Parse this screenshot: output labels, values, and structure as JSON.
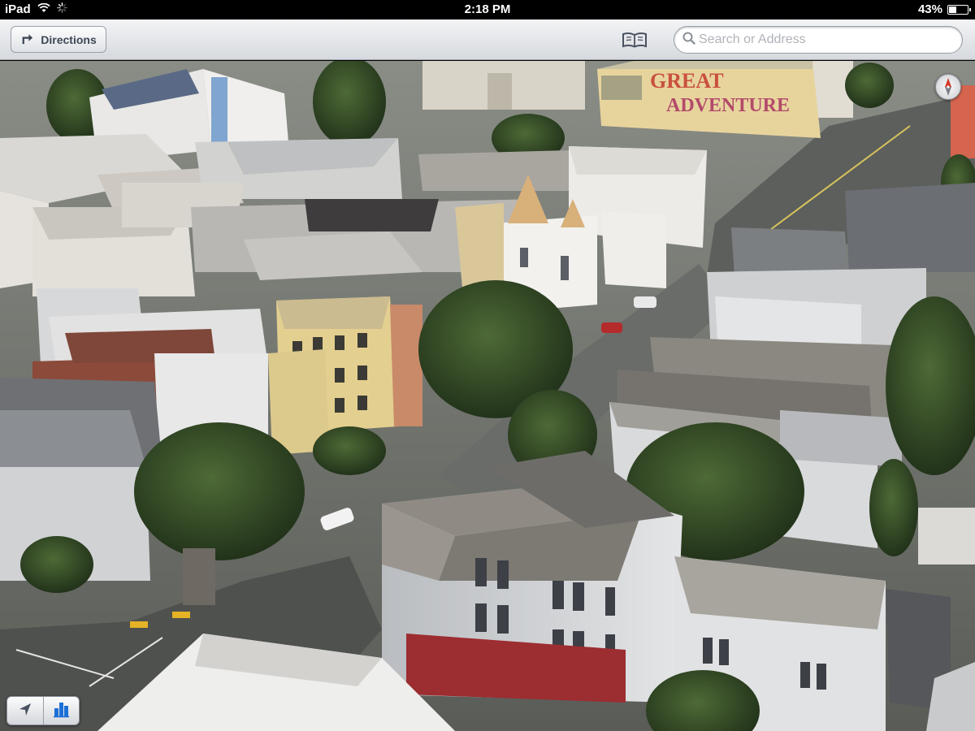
{
  "status_bar": {
    "device": "iPad",
    "time": "2:18 PM",
    "battery_percent": "43%",
    "battery_level": 0.43
  },
  "toolbar": {
    "directions_label": "Directions",
    "search_placeholder": "Search or Address",
    "search_value": ""
  },
  "map": {
    "mode": "3D flyover",
    "mural_text": "GREAT ADVENTURE"
  },
  "icons": {
    "wifi": "wifi-icon",
    "activity": "activity-spinner-icon",
    "directions": "turn-arrow-icon",
    "bookmarks": "bookmarks-icon",
    "search": "magnifier-icon",
    "compass": "compass-icon",
    "location": "location-arrow-icon",
    "mode": "3d-buildings-icon"
  },
  "colors": {
    "accent_blue": "#1c6fd6",
    "toolbar_top": "#f3f4f6",
    "toolbar_bottom": "#d6d9de"
  }
}
